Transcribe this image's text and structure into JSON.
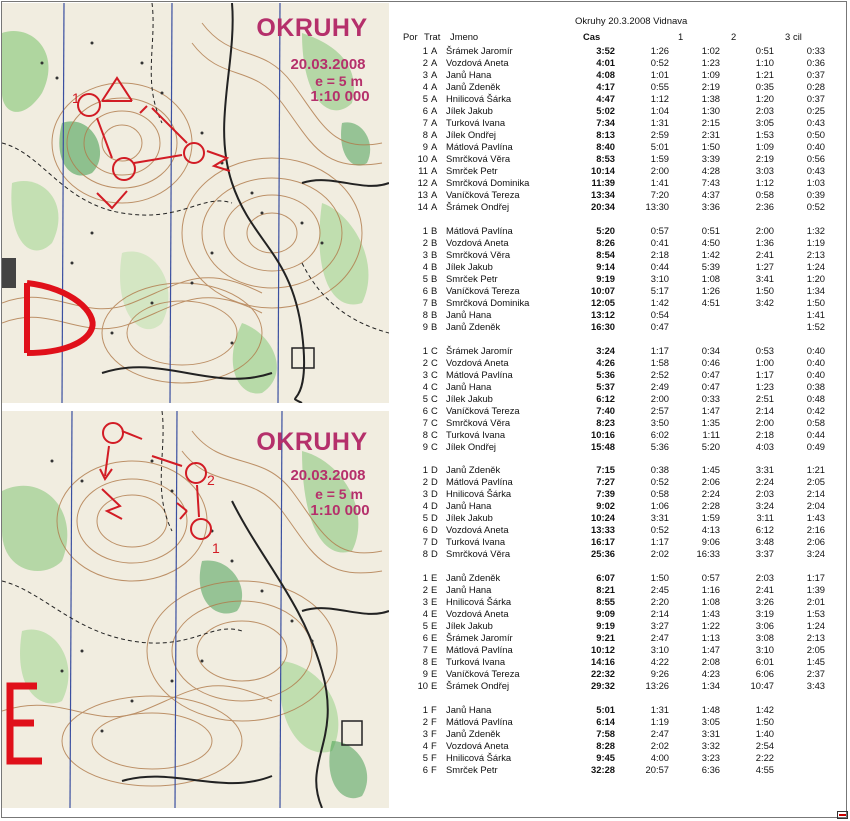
{
  "maps": [
    {
      "title": "OKRUHY",
      "date": "20.03.2008",
      "equidistance": "e =  5 m",
      "scale": "1:10 000",
      "course_letter": "D"
    },
    {
      "title": "OKRUHY",
      "date": "20.03.2008",
      "equidistance": "e =  5 m",
      "scale": "1:10 000",
      "course_letter": "E"
    }
  ],
  "results": {
    "title": "Okruhy 20.3.2008 Vidnava",
    "headers": {
      "por": "Por",
      "trat": "Trat",
      "jmeno": "Jmeno",
      "cas": "Cas",
      "s1": "1",
      "s2": "2",
      "s3": "3",
      "s4": "cil"
    },
    "groups": [
      {
        "rows": [
          [
            "1",
            "A",
            "Šrámek Jaromír",
            "3:52",
            "1:26",
            "1:02",
            "0:51",
            "0:33"
          ],
          [
            "2",
            "A",
            "Vozdová Aneta",
            "4:01",
            "0:52",
            "1:23",
            "1:10",
            "0:36"
          ],
          [
            "3",
            "A",
            "Janů Hana",
            "4:08",
            "1:01",
            "1:09",
            "1:21",
            "0:37"
          ],
          [
            "4",
            "A",
            "Janů Zdeněk",
            "4:17",
            "0:55",
            "2:19",
            "0:35",
            "0:28"
          ],
          [
            "5",
            "A",
            "Hnilicová Šárka",
            "4:47",
            "1:12",
            "1:38",
            "1:20",
            "0:37"
          ],
          [
            "6",
            "A",
            "Jílek Jakub",
            "5:02",
            "1:04",
            "1:30",
            "2:03",
            "0:25"
          ],
          [
            "7",
            "A",
            "Turková Ivana",
            "7:34",
            "1:31",
            "2:15",
            "3:05",
            "0:43"
          ],
          [
            "8",
            "A",
            "Jílek Ondřej",
            "8:13",
            "2:59",
            "2:31",
            "1:53",
            "0:50"
          ],
          [
            "9",
            "A",
            "Mátlová Pavlína",
            "8:40",
            "5:01",
            "1:50",
            "1:09",
            "0:40"
          ],
          [
            "10",
            "A",
            "Smrčková Věra",
            "8:53",
            "1:59",
            "3:39",
            "2:19",
            "0:56"
          ],
          [
            "11",
            "A",
            "Smrček Petr",
            "10:14",
            "2:00",
            "4:28",
            "3:03",
            "0:43"
          ],
          [
            "12",
            "A",
            "Smrčková Dominika",
            "11:39",
            "1:41",
            "7:43",
            "1:12",
            "1:03"
          ],
          [
            "13",
            "A",
            "Vaníčková Tereza",
            "13:34",
            "7:20",
            "4:37",
            "0:58",
            "0:39"
          ],
          [
            "14",
            "A",
            "Šrámek Ondřej",
            "20:34",
            "13:30",
            "3:36",
            "2:36",
            "0:52"
          ]
        ]
      },
      {
        "rows": [
          [
            "1",
            "B",
            "Mátlová Pavlína",
            "5:20",
            "0:57",
            "0:51",
            "2:00",
            "1:32"
          ],
          [
            "2",
            "B",
            "Vozdová Aneta",
            "8:26",
            "0:41",
            "4:50",
            "1:36",
            "1:19"
          ],
          [
            "3",
            "B",
            "Smrčková Věra",
            "8:54",
            "2:18",
            "1:42",
            "2:41",
            "2:13"
          ],
          [
            "4",
            "B",
            "Jílek Jakub",
            "9:14",
            "0:44",
            "5:39",
            "1:27",
            "1:24"
          ],
          [
            "5",
            "B",
            "Smrček Petr",
            "9:19",
            "3:10",
            "1:08",
            "3:41",
            "1:20"
          ],
          [
            "6",
            "B",
            "Vaníčková Tereza",
            "10:07",
            "5:17",
            "1:26",
            "1:50",
            "1:34"
          ],
          [
            "7",
            "B",
            "Smrčková Dominika",
            "12:05",
            "1:42",
            "4:51",
            "3:42",
            "1:50"
          ],
          [
            "8",
            "B",
            "Janů Hana",
            "13:12",
            "0:54",
            "",
            "",
            "1:41"
          ],
          [
            "9",
            "B",
            "Janů Zdeněk",
            "16:30",
            "0:47",
            "",
            "",
            "1:52"
          ]
        ]
      },
      {
        "rows": [
          [
            "1",
            "C",
            "Šrámek Jaromír",
            "3:24",
            "1:17",
            "0:34",
            "0:53",
            "0:40"
          ],
          [
            "2",
            "C",
            "Vozdová Aneta",
            "4:26",
            "1:58",
            "0:46",
            "1:00",
            "0:40"
          ],
          [
            "3",
            "C",
            "Mátlová Pavlína",
            "5:36",
            "2:52",
            "0:47",
            "1:17",
            "0:40"
          ],
          [
            "4",
            "C",
            "Janů Hana",
            "5:37",
            "2:49",
            "0:47",
            "1:23",
            "0:38"
          ],
          [
            "5",
            "C",
            "Jílek Jakub",
            "6:12",
            "2:00",
            "0:33",
            "2:51",
            "0:48"
          ],
          [
            "6",
            "C",
            "Vaníčková Tereza",
            "7:40",
            "2:57",
            "1:47",
            "2:14",
            "0:42"
          ],
          [
            "7",
            "C",
            "Smrčková Věra",
            "8:23",
            "3:50",
            "1:35",
            "2:00",
            "0:58"
          ],
          [
            "8",
            "C",
            "Turková Ivana",
            "10:16",
            "6:02",
            "1:11",
            "2:18",
            "0:44"
          ],
          [
            "9",
            "C",
            "Jílek Ondřej",
            "15:48",
            "5:36",
            "5:20",
            "4:03",
            "0:49"
          ]
        ]
      },
      {
        "rows": [
          [
            "1",
            "D",
            "Janů Zdeněk",
            "7:15",
            "0:38",
            "1:45",
            "3:31",
            "1:21"
          ],
          [
            "2",
            "D",
            "Mátlová Pavlína",
            "7:27",
            "0:52",
            "2:06",
            "2:24",
            "2:05"
          ],
          [
            "3",
            "D",
            "Hnilicová Šárka",
            "7:39",
            "0:58",
            "2:24",
            "2:03",
            "2:14"
          ],
          [
            "4",
            "D",
            "Janů Hana",
            "9:02",
            "1:06",
            "2:28",
            "3:24",
            "2:04"
          ],
          [
            "5",
            "D",
            "Jílek Jakub",
            "10:24",
            "3:31",
            "1:59",
            "3:11",
            "1:43"
          ],
          [
            "6",
            "D",
            "Vozdová Aneta",
            "13:33",
            "0:52",
            "4:13",
            "6:12",
            "2:16"
          ],
          [
            "7",
            "D",
            "Turková Ivana",
            "16:17",
            "1:17",
            "9:06",
            "3:48",
            "2:06"
          ],
          [
            "8",
            "D",
            "Smrčková Věra",
            "25:36",
            "2:02",
            "16:33",
            "3:37",
            "3:24"
          ]
        ]
      },
      {
        "rows": [
          [
            "1",
            "E",
            "Janů Zdeněk",
            "6:07",
            "1:50",
            "0:57",
            "2:03",
            "1:17"
          ],
          [
            "2",
            "E",
            "Janů Hana",
            "8:21",
            "2:45",
            "1:16",
            "2:41",
            "1:39"
          ],
          [
            "3",
            "E",
            "Hnilicová Šárka",
            "8:55",
            "2:20",
            "1:08",
            "3:26",
            "2:01"
          ],
          [
            "4",
            "E",
            "Vozdová Aneta",
            "9:09",
            "2:14",
            "1:43",
            "3:19",
            "1:53"
          ],
          [
            "5",
            "E",
            "Jílek Jakub",
            "9:19",
            "3:27",
            "1:22",
            "3:06",
            "1:24"
          ],
          [
            "6",
            "E",
            "Šrámek Jaromír",
            "9:21",
            "2:47",
            "1:13",
            "3:08",
            "2:13"
          ],
          [
            "7",
            "E",
            "Mátlová Pavlína",
            "10:12",
            "3:10",
            "1:47",
            "3:10",
            "2:05"
          ],
          [
            "8",
            "E",
            "Turková Ivana",
            "14:16",
            "4:22",
            "2:08",
            "6:01",
            "1:45"
          ],
          [
            "9",
            "E",
            "Vaníčková Tereza",
            "22:32",
            "9:26",
            "4:23",
            "6:06",
            "2:37"
          ],
          [
            "10",
            "E",
            "Šrámek Ondřej",
            "29:32",
            "13:26",
            "1:34",
            "10:47",
            "3:43"
          ]
        ]
      },
      {
        "rows": [
          [
            "1",
            "F",
            "Janů Hana",
            "5:01",
            "1:31",
            "1:48",
            "1:42",
            ""
          ],
          [
            "2",
            "F",
            "Mátlová Pavlína",
            "6:14",
            "1:19",
            "3:05",
            "1:50",
            ""
          ],
          [
            "3",
            "F",
            "Janů Zdeněk",
            "7:58",
            "2:47",
            "3:31",
            "1:40",
            ""
          ],
          [
            "4",
            "F",
            "Vozdová Aneta",
            "8:28",
            "2:02",
            "3:32",
            "2:54",
            ""
          ],
          [
            "5",
            "F",
            "Hnilicová Šárka",
            "9:45",
            "4:00",
            "3:23",
            "2:22",
            ""
          ],
          [
            "6",
            "F",
            "Smrček Petr",
            "32:28",
            "20:57",
            "6:36",
            "4:55",
            ""
          ]
        ]
      }
    ]
  }
}
